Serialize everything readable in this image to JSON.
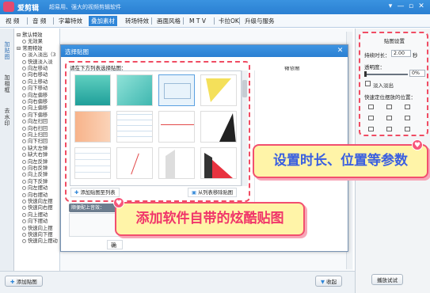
{
  "app": {
    "title": "爱剪辑",
    "subtitle": "超易用、强大的视频剪辑软件",
    "window_controls": [
      "▾",
      "—",
      "▫",
      "✕"
    ]
  },
  "menu": {
    "items": [
      "视 频",
      "音 频",
      "字幕特效",
      "叠加素材",
      "转场特效",
      "画面风格",
      "M T V",
      "卡拉OK",
      "升级与服务"
    ],
    "active_index": 3
  },
  "vtabs": [
    "加\n贴\n图",
    "加\n相\n框",
    "去\n水\n印"
  ],
  "effects": {
    "groups": [
      {
        "label": "默认特效",
        "items": [
          "无效果"
        ]
      },
      {
        "label": "常用特效",
        "items": [
          "淡入淡出（3",
          "快速淡入淡",
          "向左移动",
          "向右移动",
          "向上移动",
          "向下移动",
          "向左偏移",
          "向右偏移",
          "向上偏移",
          "向下偏移",
          "向左扫回",
          "向右扫回",
          "向上扫回",
          "向下扫回",
          "缺大左弹",
          "缺大右弹",
          "向左反弹",
          "向右反弹",
          "向上反弹",
          "向下反弹",
          "向左摆动",
          "向右摆动",
          "快速向左摆",
          "快速向右摆",
          "向上摆动",
          "向下摆动",
          "快速向上摆",
          "快速向下摆",
          "快速向上摆动"
        ]
      }
    ]
  },
  "settings": {
    "title": "贴图设置",
    "duration_label": "持续时长：",
    "duration_value": "2.00",
    "duration_unit": "秒",
    "opacity_label": "透明度：",
    "opacity_value": "0%",
    "fade_label": "淡入淡出",
    "position_label": "快速定位摆放的位置："
  },
  "dialog": {
    "title": "选择贴图",
    "hint": "请在下方列表选择贴图：",
    "preview_label": "预览图",
    "add_button": "添加贴图至列表",
    "remove_button": "从列表移除贴图",
    "music_label": "顺便配上音效：",
    "ok_button": "确",
    "close_icon": "✕"
  },
  "bottom": {
    "add_button": "添加贴图",
    "collapse_button": "收起",
    "preview_button": "播放试试"
  },
  "callouts": {
    "settings": "设置时长、位置等参数",
    "stickers": "添加软件自带的炫酷贴图"
  },
  "colors": {
    "accent_blue": "#2f86d8",
    "callout_pink": "#f24f6f",
    "callout_yellow": "#fff4a8"
  }
}
